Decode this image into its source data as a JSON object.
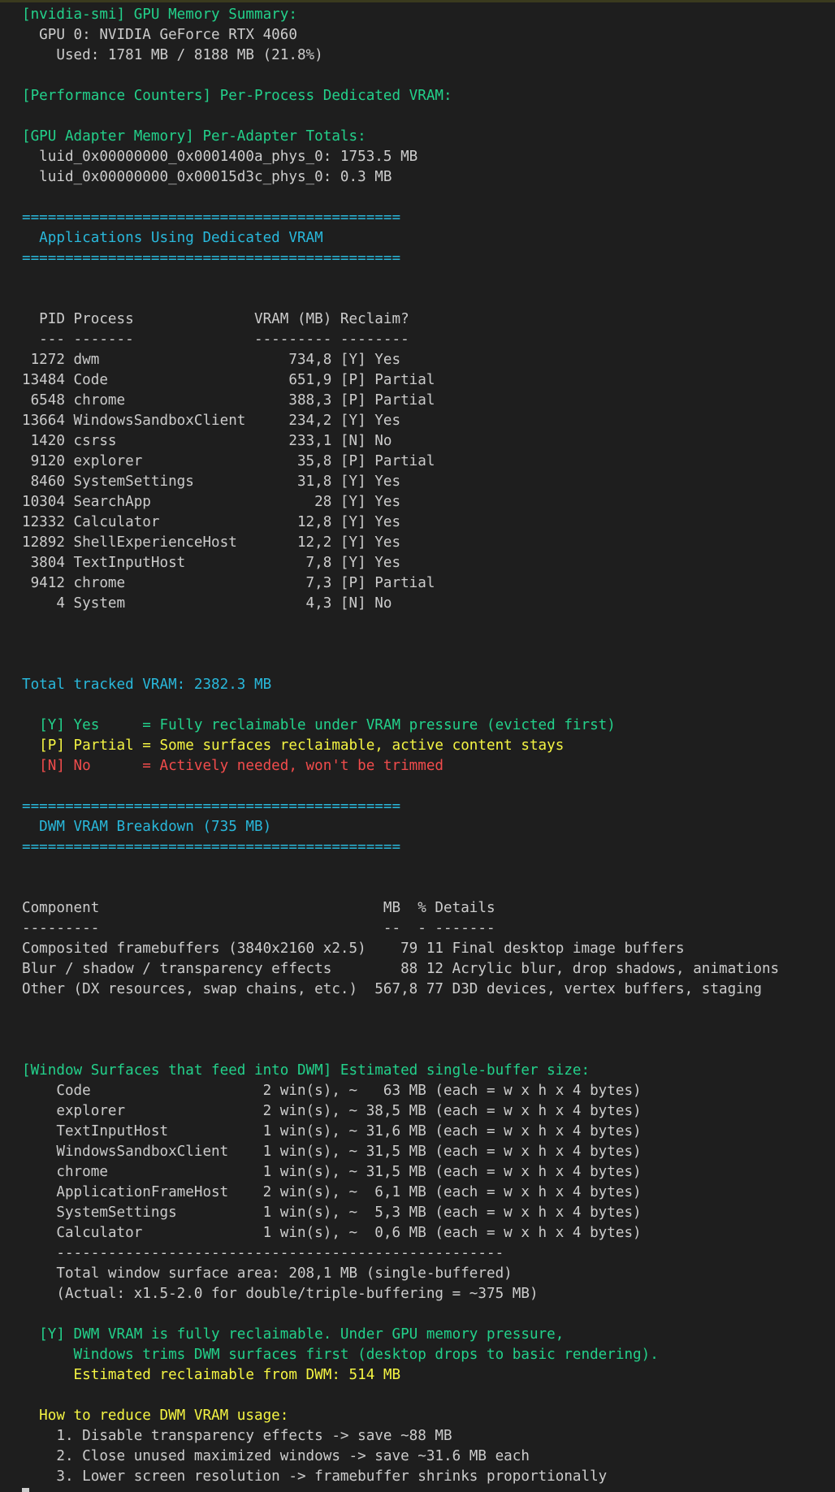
{
  "terminal": {
    "lines": [
      {
        "text": "[nvidia-smi] GPU Memory Summary:",
        "color": "green"
      },
      {
        "text": "  GPU 0: NVIDIA GeForce RTX 4060",
        "color": "white"
      },
      {
        "text": "    Used: 1781 MB / 8188 MB (21.8%)",
        "color": "white"
      },
      {
        "text": "",
        "color": "white"
      },
      {
        "text": "[Performance Counters] Per-Process Dedicated VRAM:",
        "color": "green"
      },
      {
        "text": "",
        "color": "white"
      },
      {
        "text": "[GPU Adapter Memory] Per-Adapter Totals:",
        "color": "green"
      },
      {
        "text": "  luid_0x00000000_0x0001400a_phys_0: 1753.5 MB",
        "color": "white"
      },
      {
        "text": "  luid_0x00000000_0x00015d3c_phys_0: 0.3 MB",
        "color": "white"
      },
      {
        "text": "",
        "color": "white"
      },
      {
        "text": "============================================",
        "color": "cyan"
      },
      {
        "text": "  Applications Using Dedicated VRAM",
        "color": "cyan"
      },
      {
        "text": "============================================",
        "color": "cyan"
      },
      {
        "text": "",
        "color": "white"
      },
      {
        "text": "",
        "color": "white"
      },
      {
        "text": "  PID Process              VRAM (MB) Reclaim?",
        "color": "white"
      },
      {
        "text": "  --- -------              --------- --------",
        "color": "white"
      },
      {
        "text": " 1272 dwm                      734,8 [Y] Yes",
        "color": "white"
      },
      {
        "text": "13484 Code                     651,9 [P] Partial",
        "color": "white"
      },
      {
        "text": " 6548 chrome                   388,3 [P] Partial",
        "color": "white"
      },
      {
        "text": "13664 WindowsSandboxClient     234,2 [Y] Yes",
        "color": "white"
      },
      {
        "text": " 1420 csrss                    233,1 [N] No",
        "color": "white"
      },
      {
        "text": " 9120 explorer                  35,8 [P] Partial",
        "color": "white"
      },
      {
        "text": " 8460 SystemSettings            31,8 [Y] Yes",
        "color": "white"
      },
      {
        "text": "10304 SearchApp                   28 [Y] Yes",
        "color": "white"
      },
      {
        "text": "12332 Calculator                12,8 [Y] Yes",
        "color": "white"
      },
      {
        "text": "12892 ShellExperienceHost       12,2 [Y] Yes",
        "color": "white"
      },
      {
        "text": " 3804 TextInputHost              7,8 [Y] Yes",
        "color": "white"
      },
      {
        "text": " 9412 chrome                     7,3 [P] Partial",
        "color": "white"
      },
      {
        "text": "    4 System                     4,3 [N] No",
        "color": "white"
      },
      {
        "text": "",
        "color": "white"
      },
      {
        "text": "",
        "color": "white"
      },
      {
        "text": "",
        "color": "white"
      },
      {
        "text": "Total tracked VRAM: 2382.3 MB",
        "color": "cyan"
      },
      {
        "text": "",
        "color": "white"
      },
      {
        "text": "  [Y] Yes     = Fully reclaimable under VRAM pressure (evicted first)",
        "color": "green"
      },
      {
        "text": "  [P] Partial = Some surfaces reclaimable, active content stays",
        "color": "yellow"
      },
      {
        "text": "  [N] No      = Actively needed, won't be trimmed",
        "color": "red"
      },
      {
        "text": "",
        "color": "white"
      },
      {
        "text": "============================================",
        "color": "cyan"
      },
      {
        "text": "  DWM VRAM Breakdown (735 MB)",
        "color": "cyan"
      },
      {
        "text": "============================================",
        "color": "cyan"
      },
      {
        "text": "",
        "color": "white"
      },
      {
        "text": "",
        "color": "white"
      },
      {
        "text": "Component                                 MB  % Details",
        "color": "white"
      },
      {
        "text": "---------                                 --  - -------",
        "color": "white"
      },
      {
        "text": "Composited framebuffers (3840x2160 x2.5)    79 11 Final desktop image buffers",
        "color": "white"
      },
      {
        "text": "Blur / shadow / transparency effects        88 12 Acrylic blur, drop shadows, animations",
        "color": "white"
      },
      {
        "text": "Other (DX resources, swap chains, etc.)  567,8 77 D3D devices, vertex buffers, staging",
        "color": "white"
      },
      {
        "text": "",
        "color": "white"
      },
      {
        "text": "",
        "color": "white"
      },
      {
        "text": "",
        "color": "white"
      },
      {
        "text": "[Window Surfaces that feed into DWM] Estimated single-buffer size:",
        "color": "green"
      },
      {
        "text": "    Code                    2 win(s), ~   63 MB (each = w x h x 4 bytes)",
        "color": "white"
      },
      {
        "text": "    explorer                2 win(s), ~ 38,5 MB (each = w x h x 4 bytes)",
        "color": "white"
      },
      {
        "text": "    TextInputHost           1 win(s), ~ 31,6 MB (each = w x h x 4 bytes)",
        "color": "white"
      },
      {
        "text": "    WindowsSandboxClient    1 win(s), ~ 31,5 MB (each = w x h x 4 bytes)",
        "color": "white"
      },
      {
        "text": "    chrome                  1 win(s), ~ 31,5 MB (each = w x h x 4 bytes)",
        "color": "white"
      },
      {
        "text": "    ApplicationFrameHost    2 win(s), ~  6,1 MB (each = w x h x 4 bytes)",
        "color": "white"
      },
      {
        "text": "    SystemSettings          1 win(s), ~  5,3 MB (each = w x h x 4 bytes)",
        "color": "white"
      },
      {
        "text": "    Calculator              1 win(s), ~  0,6 MB (each = w x h x 4 bytes)",
        "color": "white"
      },
      {
        "text": "    ----------------------------------------------------",
        "color": "white"
      },
      {
        "text": "    Total window surface area: 208,1 MB (single-buffered)",
        "color": "white"
      },
      {
        "text": "    (Actual: x1.5-2.0 for double/triple-buffering = ~375 MB)",
        "color": "white"
      },
      {
        "text": "",
        "color": "white"
      },
      {
        "text": "  [Y] DWM VRAM is fully reclaimable. Under GPU memory pressure,",
        "color": "green"
      },
      {
        "text": "      Windows trims DWM surfaces first (desktop drops to basic rendering).",
        "color": "green"
      },
      {
        "text": "      Estimated reclaimable from DWM: 514 MB",
        "color": "yellow"
      },
      {
        "text": "",
        "color": "white"
      },
      {
        "text": "  How to reduce DWM VRAM usage:",
        "color": "yellow"
      },
      {
        "text": "    1. Disable transparency effects -> save ~88 MB",
        "color": "white"
      },
      {
        "text": "    2. Close unused maximized windows -> save ~31.6 MB each",
        "color": "white"
      },
      {
        "text": "    3. Lower screen resolution -> framebuffer shrinks proportionally",
        "color": "white"
      }
    ]
  },
  "colors": {
    "background": "#1e1e1e",
    "white": "#cccccc",
    "green": "#23d18b",
    "cyan": "#29b8db",
    "yellow": "#f5f543",
    "red": "#f14c4c"
  }
}
